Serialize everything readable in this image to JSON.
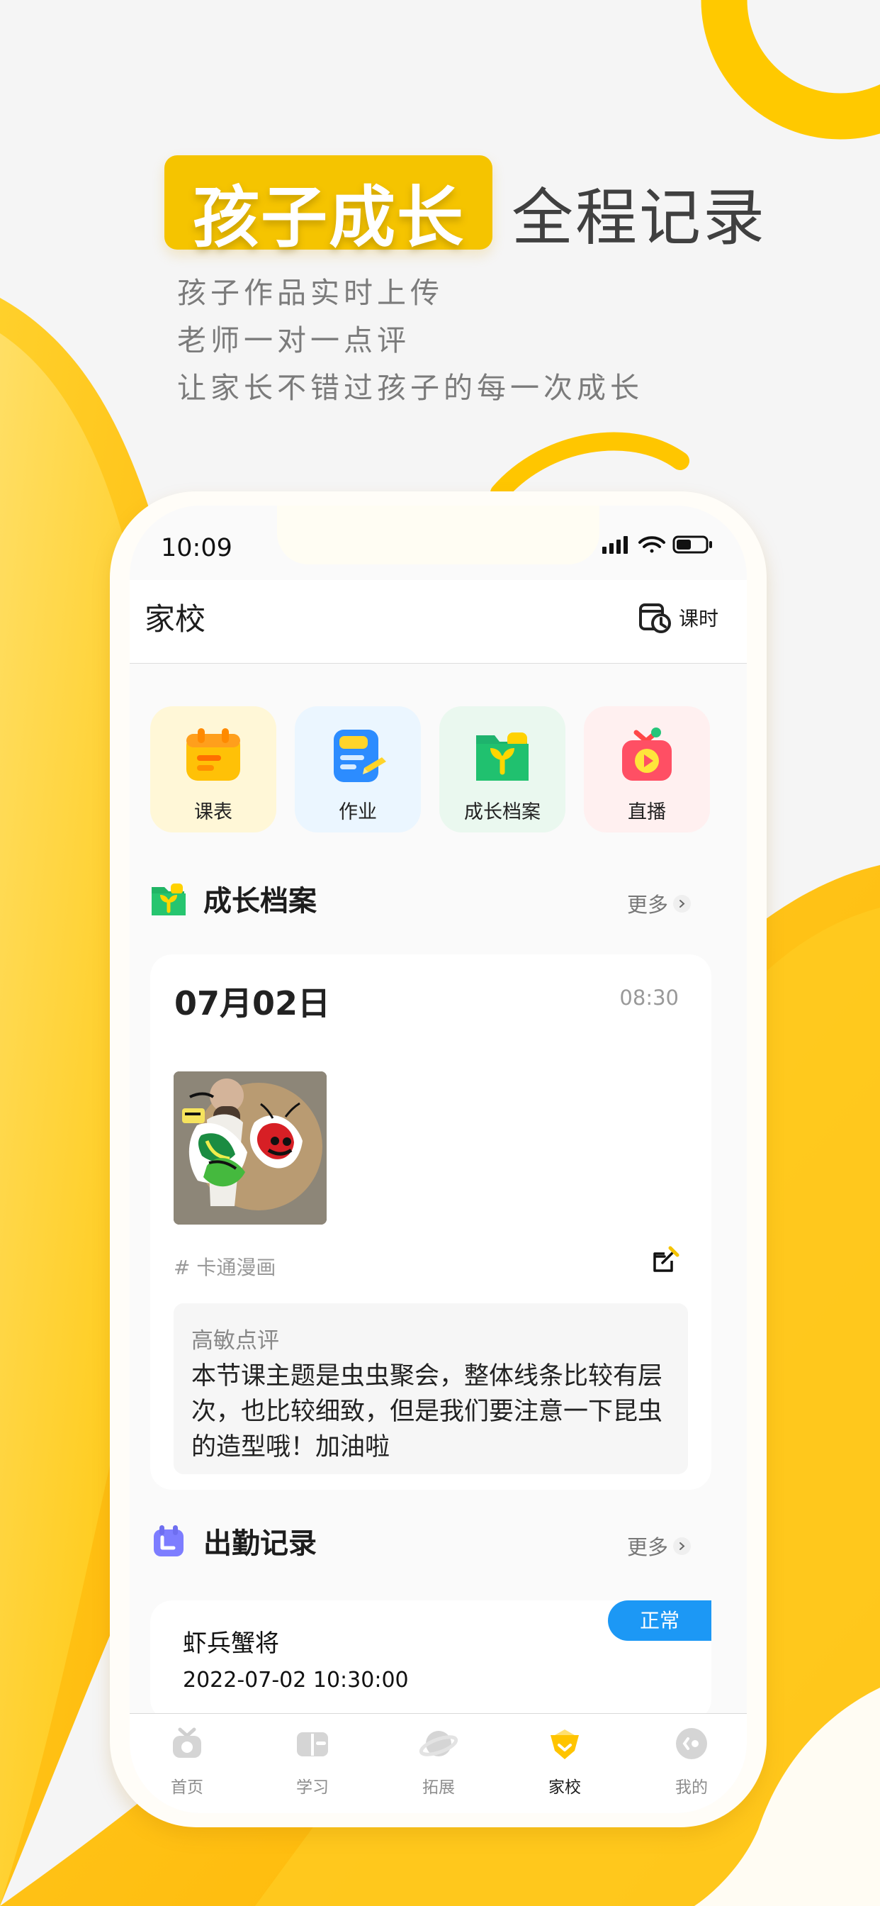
{
  "promo": {
    "headline_highlight": "孩子成长",
    "headline_text": "全程记录",
    "lines": [
      "孩子作品实时上传",
      "老师一对一点评",
      "让家长不错过孩子的每一次成长"
    ]
  },
  "status_bar": {
    "time": "10:09"
  },
  "header": {
    "title": "家校",
    "lesson_label": "课时"
  },
  "quick_actions": [
    {
      "label": "课表"
    },
    {
      "label": "作业"
    },
    {
      "label": "成长档案"
    },
    {
      "label": "直播"
    }
  ],
  "growth_section": {
    "title": "成长档案",
    "more": "更多",
    "record": {
      "date": "07月02日",
      "time": "08:30",
      "tag": "# 卡通漫画",
      "comment_author": "高敏点评",
      "comment_text": "本节课主题是虫虫聚会，整体线条比较有层次，也比较细致，但是我们要注意一下昆虫的造型哦！加油啦"
    }
  },
  "attendance_section": {
    "title": "出勤记录",
    "more": "更多",
    "item": {
      "name": "虾兵蟹将",
      "datetime": "2022-07-02 10:30:00",
      "status": "正常"
    }
  },
  "tabbar": [
    {
      "label": "首页"
    },
    {
      "label": "学习"
    },
    {
      "label": "拓展"
    },
    {
      "label": "家校"
    },
    {
      "label": "我的"
    }
  ],
  "colors": {
    "accent_yellow": "#f5c400",
    "badge_blue": "#1c98f5"
  }
}
